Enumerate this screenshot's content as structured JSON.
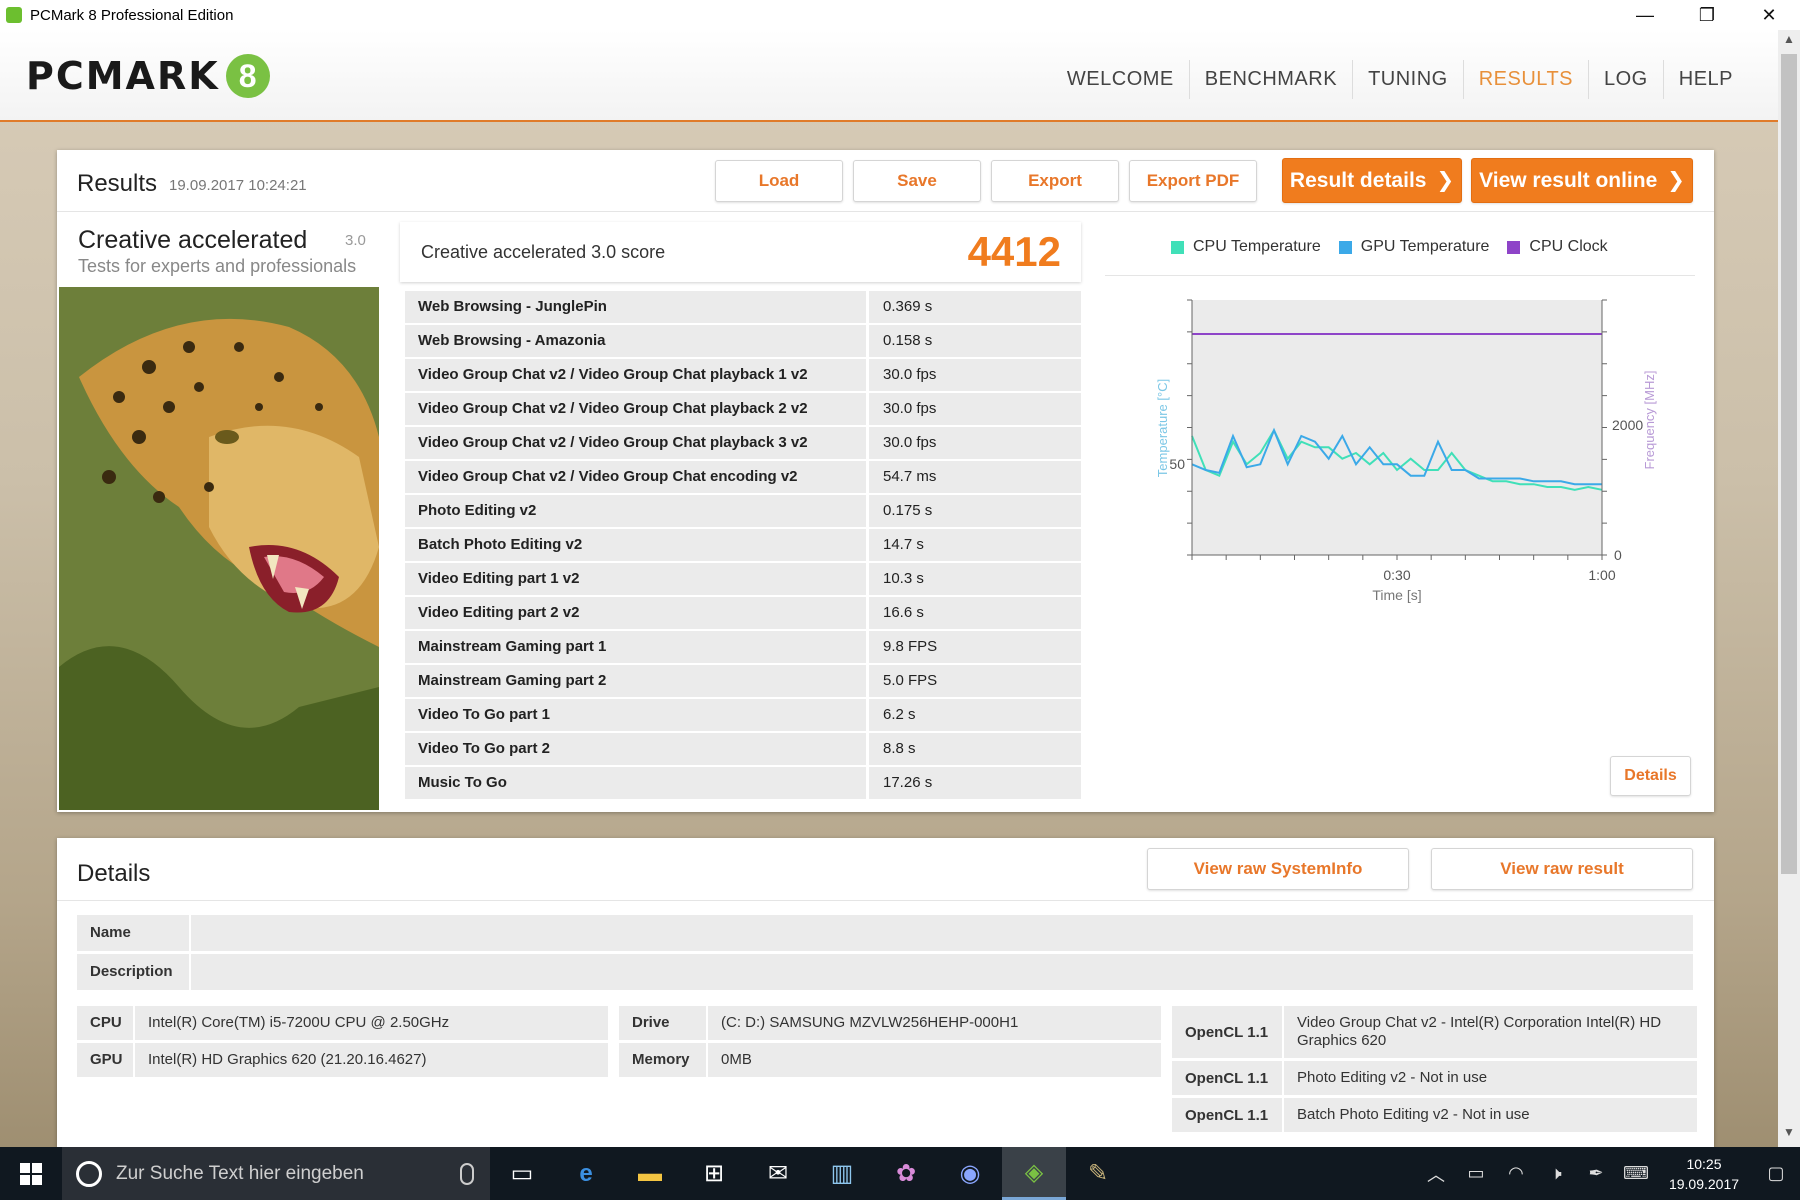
{
  "window": {
    "title": "PCMark 8 Professional Edition",
    "minimize": "—",
    "restore": "❐",
    "close": "✕"
  },
  "header": {
    "logo_text": "PCMARK",
    "logo_badge": "8",
    "nav": [
      {
        "label": "WELCOME"
      },
      {
        "label": "BENCHMARK"
      },
      {
        "label": "TUNING"
      },
      {
        "label": "RESULTS",
        "active": true
      },
      {
        "label": "LOG"
      },
      {
        "label": "HELP"
      }
    ]
  },
  "results": {
    "title": "Results",
    "date": "19.09.2017 10:24:21",
    "buttons": {
      "load": "Load",
      "save": "Save",
      "export": "Export",
      "export_pdf": "Export PDF",
      "result_details": "Result details",
      "view_online": "View result online"
    },
    "test": {
      "name": "Creative accelerated",
      "version": "3.0",
      "subtitle": "Tests for experts and professionals"
    },
    "score": {
      "label": "Creative accelerated 3.0 score",
      "value": "4412"
    },
    "rows": [
      {
        "name": "Web Browsing - JunglePin",
        "value": "0.369 s"
      },
      {
        "name": "Web Browsing - Amazonia",
        "value": "0.158 s"
      },
      {
        "name": "Video Group Chat v2 / Video Group Chat playback 1 v2",
        "value": "30.0 fps"
      },
      {
        "name": "Video Group Chat v2 / Video Group Chat playback 2 v2",
        "value": "30.0 fps"
      },
      {
        "name": "Video Group Chat v2 / Video Group Chat playback 3 v2",
        "value": "30.0 fps"
      },
      {
        "name": "Video Group Chat v2 / Video Group Chat encoding v2",
        "value": "54.7 ms"
      },
      {
        "name": "Photo Editing v2",
        "value": "0.175 s"
      },
      {
        "name": "Batch Photo Editing v2",
        "value": "14.7 s"
      },
      {
        "name": "Video Editing part 1 v2",
        "value": "10.3 s"
      },
      {
        "name": "Video Editing part 2 v2",
        "value": "16.6 s"
      },
      {
        "name": "Mainstream Gaming part 1",
        "value": "9.8 FPS"
      },
      {
        "name": "Mainstream Gaming part 2",
        "value": "5.0 FPS"
      },
      {
        "name": "Video To Go part 1",
        "value": "6.2 s"
      },
      {
        "name": "Video To Go part 2",
        "value": "8.8 s"
      },
      {
        "name": "Music To Go",
        "value": "17.26 s"
      }
    ],
    "details_button": "Details"
  },
  "chart_data": {
    "type": "line",
    "title": "",
    "xlabel": "Time [s]",
    "ylabel": "Temperature [°C]",
    "y2label": "Frequency [MHz]",
    "x_ticks": [
      "0:30",
      "1:00"
    ],
    "y_ticks": [
      "50"
    ],
    "y2_ticks": [
      "2000",
      "0"
    ],
    "xlim": [
      0,
      60
    ],
    "ylim": [
      35,
      80
    ],
    "y2lim": [
      0,
      4500
    ],
    "grid": false,
    "legend_position": "top",
    "series": [
      {
        "name": "CPU Temperature",
        "color": "#40e0b8",
        "axis": "left",
        "x": [
          0,
          2,
          4,
          6,
          8,
          10,
          12,
          14,
          16,
          18,
          20,
          22,
          24,
          26,
          28,
          30,
          32,
          34,
          36,
          38,
          40,
          42,
          44,
          46,
          48,
          50,
          52,
          54,
          56,
          58,
          60
        ],
        "y": [
          56,
          50,
          49,
          55,
          51,
          53,
          57,
          52,
          55,
          54,
          54,
          52,
          53,
          51,
          53,
          50,
          52,
          50,
          50,
          53,
          50,
          49,
          48,
          48,
          47.5,
          47.5,
          47,
          47,
          46.5,
          47,
          46.5
        ]
      },
      {
        "name": "GPU Temperature",
        "color": "#3ba9e8",
        "axis": "left",
        "x": [
          0,
          2,
          4,
          6,
          8,
          10,
          12,
          14,
          16,
          18,
          20,
          22,
          24,
          26,
          28,
          30,
          32,
          34,
          36,
          38,
          40,
          42,
          44,
          46,
          48,
          50,
          52,
          54,
          56,
          58,
          60
        ],
        "y": [
          51,
          50,
          49.5,
          56,
          50.5,
          51,
          57,
          51,
          56,
          55,
          52,
          56,
          51,
          54,
          51,
          51,
          49,
          49,
          55,
          50,
          50,
          48.5,
          48.5,
          48.5,
          48.5,
          48,
          48,
          48,
          47.5,
          47.5,
          47.5
        ]
      },
      {
        "name": "CPU Clock",
        "color": "#8e44c8",
        "axis": "right",
        "x": [
          0,
          60
        ],
        "y": [
          3900,
          3900
        ]
      }
    ]
  },
  "details": {
    "title": "Details",
    "buttons": {
      "raw_systeminfo": "View raw SystemInfo",
      "raw_result": "View raw result"
    },
    "name_label": "Name",
    "description_label": "Description",
    "cpu_label": "CPU",
    "cpu_value": "Intel(R) Core(TM) i5-7200U CPU @ 2.50GHz",
    "gpu_label": "GPU",
    "gpu_value": "Intel(R) HD Graphics 620 (21.20.16.4627)",
    "drive_label": "Drive",
    "drive_value": "(C: D:) SAMSUNG MZVLW256HEHP-000H1",
    "memory_label": "Memory",
    "memory_value": "0MB",
    "opencl": [
      {
        "label": "OpenCL 1.1",
        "value": "Video Group Chat v2 - Intel(R) Corporation Intel(R) HD Graphics 620"
      },
      {
        "label": "OpenCL 1.1",
        "value": "Photo Editing v2 - Not in use"
      },
      {
        "label": "OpenCL 1.1",
        "value": "Batch Photo Editing v2 - Not in use"
      }
    ]
  },
  "taskbar": {
    "search_placeholder": "Zur Suche Text hier eingeben",
    "clock_time": "10:25",
    "clock_date": "19.09.2017"
  }
}
